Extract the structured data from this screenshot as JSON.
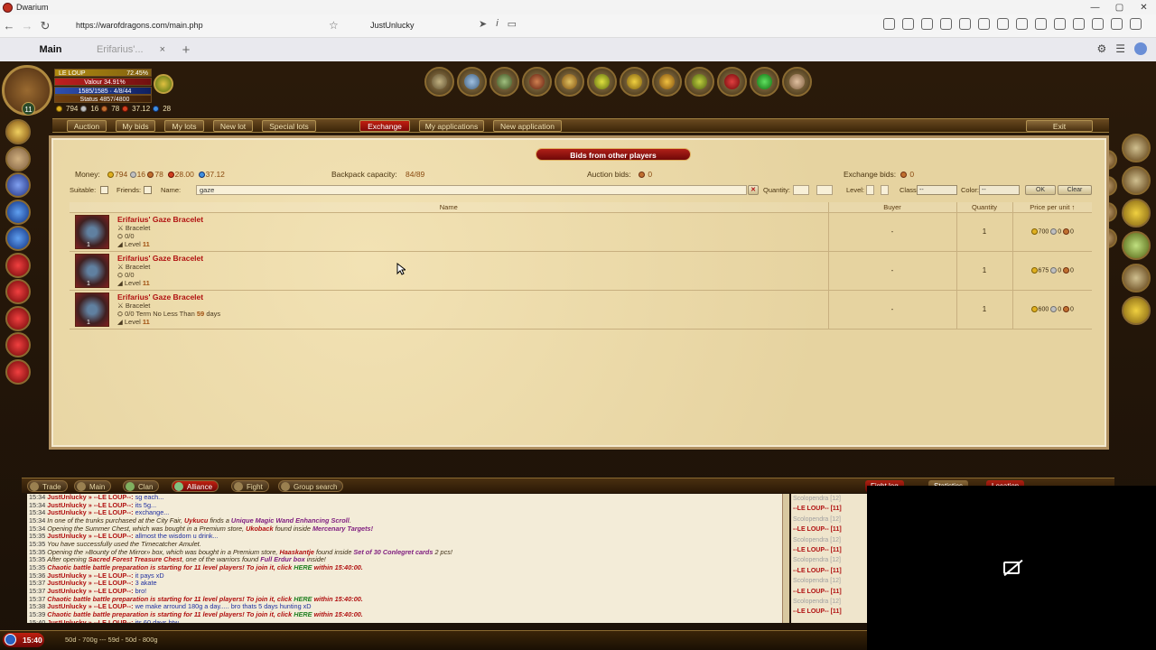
{
  "window": {
    "title": "Dwarium",
    "controls": [
      "—",
      "▢",
      "✕"
    ]
  },
  "browser": {
    "url": "https://warofdragons.com/main.php",
    "user": "JustUnlucky",
    "tabs": {
      "main": "Main",
      "second": "Erifarius'...",
      "close": "×",
      "new": "+"
    }
  },
  "hero": {
    "name": "LE LOUP",
    "name_pct": "72.45%",
    "valour": "Valour 34.91%",
    "experience": "1585/1585 · 4/8/44",
    "status": "Status 4857/4800",
    "level": "11",
    "money": {
      "gold": "794",
      "silver": "16",
      "copper": "78",
      "red": "37.12",
      "blue": "28"
    }
  },
  "menu": {
    "auction": "Auction",
    "my_bids": "My bids",
    "my_lots": "My lots",
    "new_lot": "New lot",
    "special_lots": "Special lots",
    "exchange": "Exchange",
    "my_applications": "My applications",
    "new_application": "New application",
    "exit": "Exit"
  },
  "panel": {
    "title": "Bids from other players",
    "money_label": "Money:",
    "money": {
      "gold": "794",
      "silver": "16",
      "copper": "78",
      "red": "28.00",
      "blue": "37.12"
    },
    "backpack_label": "Backpack capacity:",
    "backpack_value": "84/89",
    "auction_bids_label": "Auction bids:",
    "auction_bids_value": "0",
    "exchange_bids_label": "Exchange bids:",
    "exchange_bids_value": "0",
    "filters": {
      "suitable": "Suitable:",
      "friends": "Friends:",
      "name": "Name:",
      "name_value": "gaze",
      "clear_x": "✕",
      "quantity": "Quantity:",
      "level": "Level:",
      "class": "Class:",
      "class_value": "--",
      "color": "Color:",
      "color_value": "--",
      "ok": "OK",
      "clear": "Clear"
    },
    "columns": {
      "name": "Name",
      "buyer": "Buyer",
      "quantity": "Quantity",
      "price": "Price per unit ↑"
    },
    "rows": [
      {
        "name": "Erifarius' Gaze Bracelet",
        "type": "Bracelet",
        "durability": "0/0",
        "level_label": "Level",
        "level": "11",
        "buyer": "-",
        "qty": "1",
        "icon_qty": "1",
        "gold": "700",
        "silver": "0",
        "copper": "0"
      },
      {
        "name": "Erifarius' Gaze Bracelet",
        "type": "Bracelet",
        "durability": "0/0",
        "level_label": "Level",
        "level": "11",
        "buyer": "-",
        "qty": "1",
        "icon_qty": "1",
        "gold": "675",
        "silver": "0",
        "copper": "0"
      },
      {
        "name": "Erifarius' Gaze Bracelet",
        "type": "Bracelet",
        "durability": "0/0 Term No Less Than",
        "term_days": "59",
        "term_suffix": "days",
        "level_label": "Level",
        "level": "11",
        "buyer": "-",
        "qty": "1",
        "icon_qty": "1",
        "gold": "600",
        "silver": "0",
        "copper": "0"
      }
    ]
  },
  "chat_tabs": {
    "trade": "Trade",
    "main": "Main",
    "clan": "Clan",
    "alliance": "Alliance",
    "fight": "Fight",
    "group_search": "Group search",
    "fight_log": "Fight log",
    "statistics": "Statistics",
    "location": "Location"
  },
  "chat": [
    {
      "time": "15:34",
      "name": "JustUnlucky",
      "sep": " » --LE LOUP--: ",
      "msg": "sg each..."
    },
    {
      "time": "15:34",
      "name": "JustUnlucky",
      "sep": " » --LE LOUP--: ",
      "msg": "its 5g..."
    },
    {
      "time": "15:34",
      "name": "JustUnlucky",
      "sep": " » --LE LOUP--: ",
      "msg": "exchange..."
    },
    {
      "time": "15:34",
      "pre": "In one of the trunks purchased at the City Fair, ",
      "who": "Uykucu",
      "mid": " finds a ",
      "item": "Unique Magic Wand Enhancing Scroll",
      "post": "."
    },
    {
      "time": "15:34",
      "pre": "Opening the Summer Chest, which was bought in a Premium store, ",
      "who": "Ukoback",
      "mid": " found inside ",
      "item": "Mercenary Targets!",
      "post": ""
    },
    {
      "time": "15:35",
      "name": "JustUnlucky",
      "sep": " » --LE LOUP--: ",
      "msg": "allmost the wisdom u drink..."
    },
    {
      "time": "15:35",
      "pre": "You have successfully used the Timecatcher Amulet.",
      "who": "",
      "mid": "",
      "item": "",
      "post": ""
    },
    {
      "time": "15:35",
      "pre": "Opening the »Bounty of the Mirror» box, which was bought in a Premium store, ",
      "who": "Haaskantje",
      "mid": " found inside ",
      "item": "Set of 30 Conlegret cards",
      "post": " 2 pcs!"
    },
    {
      "time": "15:35",
      "pre": "After opening ",
      "who": "Sacred Forest Treasure Chest",
      "mid": ", one of the warriors found ",
      "item": "Full Erdur box",
      "post": " inside!"
    },
    {
      "time": "15:35",
      "battle": "Chaotic battle battle preparation is starting for 11 level players! To join it, click ",
      "here": "HERE",
      "within": " within 15:40:00."
    },
    {
      "time": "15:36",
      "name": "JustUnlucky",
      "sep": " » --LE LOUP--: ",
      "msg": "it pays xD"
    },
    {
      "time": "15:37",
      "name": "JustUnlucky",
      "sep": " » --LE LOUP--: ",
      "msg": "3 akate"
    },
    {
      "time": "15:37",
      "name": "JustUnlucky",
      "sep": " » --LE LOUP--: ",
      "msg": "bro!"
    },
    {
      "time": "15:37",
      "battle": "Chaotic battle battle preparation is starting for 11 level players! To join it, click ",
      "here": "HERE",
      "within": " within 15:40:00."
    },
    {
      "time": "15:38",
      "name": "JustUnlucky",
      "sep": " » --LE LOUP--: ",
      "msg": "we make arround 180g a day..... bro thats 5 days hunting xD"
    },
    {
      "time": "15:39",
      "battle": "Chaotic battle battle preparation is starting for 11 level players! To join it, click ",
      "here": "HERE",
      "within": " within 15:40:00."
    },
    {
      "time": "15:40",
      "name": "JustUnlucky",
      "sep": " » --LE LOUP--: ",
      "msg": "its 60 days btw"
    }
  ],
  "players": [
    {
      "n": "Scolopendra [12]",
      "c": "b"
    },
    {
      "n": "--LE LOUP-- [11]",
      "c": "a"
    },
    {
      "n": "Scolopendra [12]",
      "c": "b"
    },
    {
      "n": "--LE LOUP-- [11]",
      "c": "a"
    },
    {
      "n": "Scolopendra [12]",
      "c": "b"
    },
    {
      "n": "--LE LOUP-- [11]",
      "c": "a"
    },
    {
      "n": "Scolopendra [12]",
      "c": "b"
    },
    {
      "n": "--LE LOUP-- [11]",
      "c": "a"
    },
    {
      "n": "Scolopendra [12]",
      "c": "b"
    },
    {
      "n": "--LE LOUP-- [11]",
      "c": "a"
    },
    {
      "n": "Scolopendra [12]",
      "c": "b"
    },
    {
      "n": "--LE LOUP-- [11]",
      "c": "a"
    }
  ],
  "bottom": {
    "time": "15:40",
    "ticker": "50d - 700g --- 59d - 50d - 800g"
  },
  "colors": {
    "accent_red": "#b01010",
    "parchment": "#e9d9a8",
    "frame": "#2a1a0a"
  }
}
